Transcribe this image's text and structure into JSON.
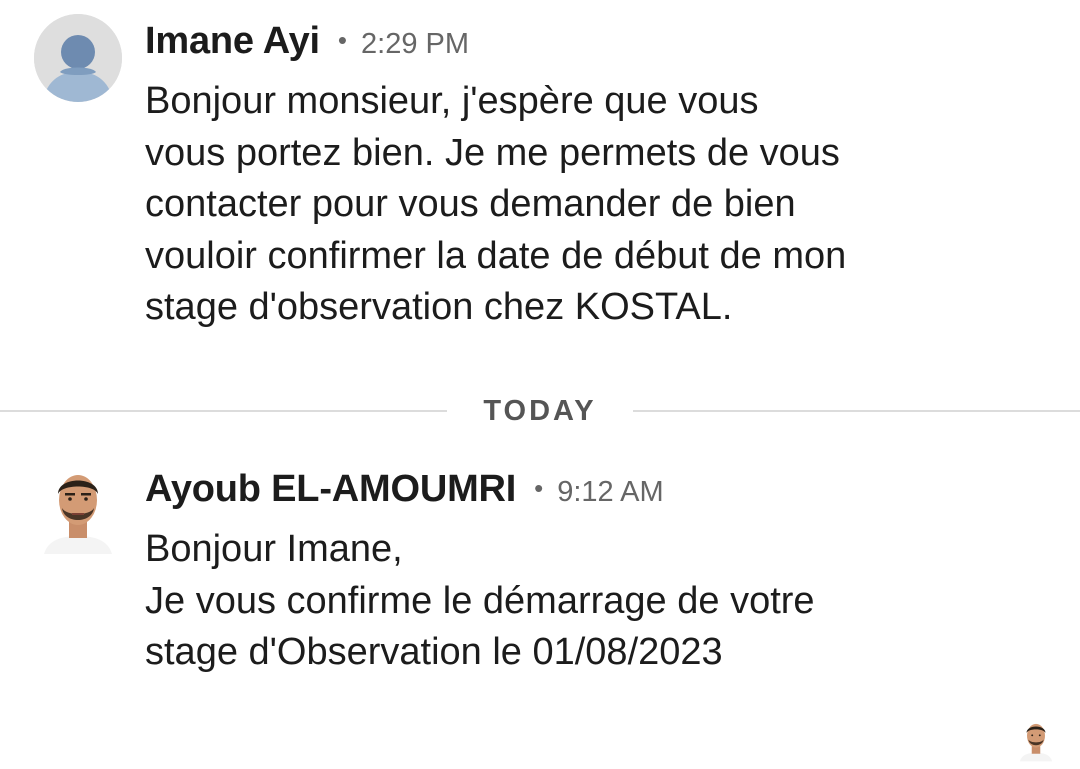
{
  "divider": {
    "label": "TODAY"
  },
  "messages": [
    {
      "sender": "Imane Ayi",
      "time": "2:29 PM",
      "avatar": "person-placeholder-icon",
      "text": "Bonjour monsieur, j'espère que vous\nvous portez bien. Je me permets de vous\ncontacter pour vous demander de bien\nvouloir confirmer la date de début de mon\nstage d'observation chez KOSTAL."
    },
    {
      "sender": "Ayoub EL-AMOUMRI",
      "time": "9:12 AM",
      "avatar": "profile-photo",
      "text": "Bonjour Imane,\nJe vous confirme le démarrage  de votre\nstage d'Observation le 01/08/2023"
    }
  ],
  "colors": {
    "text": "#1c1c1c",
    "meta": "#666666",
    "divider": "#dcdcdc",
    "placeholder_bg": "#dedede",
    "placeholder_fg": "#7f9dbf"
  }
}
